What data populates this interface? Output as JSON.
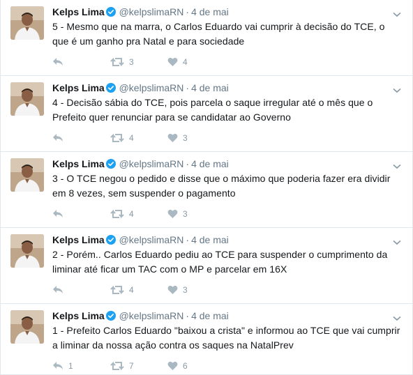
{
  "colors": {
    "accent": "#1da1f2",
    "muted": "#657786",
    "icon": "#aab8c2",
    "border": "#e1e8ed"
  },
  "tweets": [
    {
      "fullname": "Kelps Lima",
      "handle": "@kelpslimaRN",
      "sep": "·",
      "time": "4 de mai",
      "text": "5 - Mesmo que na marra, o Carlos Eduardo vai cumprir à decisão do TCE, o que é um ganho pra Natal e para sociedade",
      "reply_count": "",
      "retweet_count": "3",
      "like_count": "4"
    },
    {
      "fullname": "Kelps Lima",
      "handle": "@kelpslimaRN",
      "sep": "·",
      "time": "4 de mai",
      "text": "4 - Decisão sábia do TCE, pois parcela o saque irregular até o mês que o Prefeito quer renunciar para se candidatar ao Governo",
      "reply_count": "",
      "retweet_count": "4",
      "like_count": "3"
    },
    {
      "fullname": "Kelps Lima",
      "handle": "@kelpslimaRN",
      "sep": "·",
      "time": "4 de mai",
      "text": "3 - O TCE negou o pedido e disse que o máximo que poderia fazer era dividir em 8 vezes, sem suspender o pagamento",
      "reply_count": "",
      "retweet_count": "4",
      "like_count": "3"
    },
    {
      "fullname": "Kelps Lima",
      "handle": "@kelpslimaRN",
      "sep": "·",
      "time": "4 de mai",
      "text": "2 - Porém.. Carlos Eduardo pediu ao TCE para suspender o cumprimento da liminar até ficar um TAC com o MP e parcelar em 16X",
      "reply_count": "",
      "retweet_count": "4",
      "like_count": "3"
    },
    {
      "fullname": "Kelps Lima",
      "handle": "@kelpslimaRN",
      "sep": "·",
      "time": "4 de mai",
      "text": "1 - Prefeito Carlos Eduardo \"baixou a crista\" e informou ao TCE que vai cumprir a liminar da nossa ação contra os saques na NatalPrev",
      "reply_count": "1",
      "retweet_count": "7",
      "like_count": "6"
    }
  ]
}
